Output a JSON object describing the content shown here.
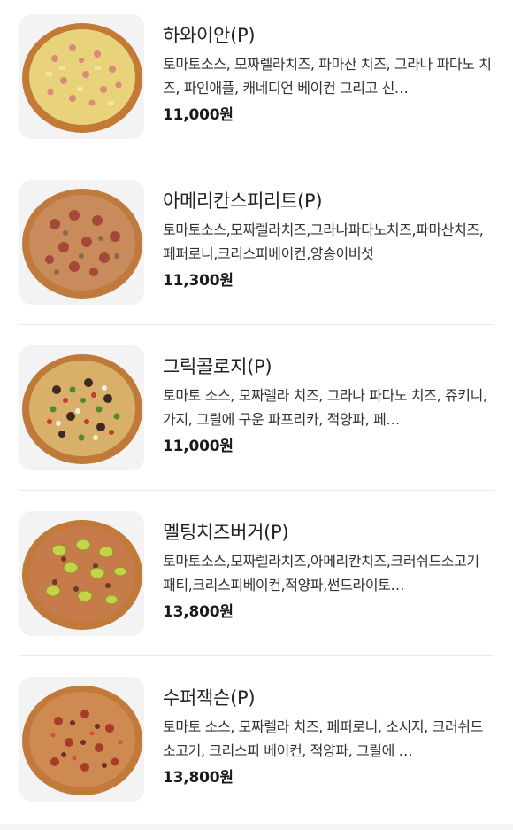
{
  "menu": {
    "items": [
      {
        "name": "하와이안(P)",
        "description": "토마토소스, 모짜렐라치즈, 파마산 치즈, 그라나 파다노 치즈, 파인애플, 캐네디언 베이컨 그리고 신…",
        "price": "11,000원",
        "image_icon": "hawaiian-pizza-image"
      },
      {
        "name": "아메리칸스피리트(P)",
        "description": "토마토소스,모짜렐라치즈,그라나파다노치즈,파마산치즈,페퍼로니,크리스피베이컨,양송이버섯",
        "price": "11,300원",
        "image_icon": "american-spirit-pizza-image"
      },
      {
        "name": "그릭콜로지(P)",
        "description": "토마토 소스, 모짜렐라 치즈, 그라나 파다노 치즈, 쥬키니, 가지, 그릴에 구운 파프리카, 적양파, 페…",
        "price": "11,000원",
        "image_icon": "greekology-pizza-image"
      },
      {
        "name": "멜팅치즈버거(P)",
        "description": "토마토소스,모짜렐라치즈,아메리칸치즈,크러쉬드소고기패티,크리스피베이컨,적양파,썬드라이토…",
        "price": "13,800원",
        "image_icon": "melting-cheese-burger-pizza-image"
      },
      {
        "name": "수퍼잭슨(P)",
        "description": "토마토 소스, 모짜렐라 치즈, 페퍼로니, 소시지, 크러쉬드 소고기, 크리스피 베이컨, 적양파, 그릴에 …",
        "price": "13,800원",
        "image_icon": "super-jackson-pizza-image"
      }
    ]
  },
  "colors": {
    "crust": "#c8843e",
    "crust_dark": "#a9652b",
    "cheese": "#e8c46a",
    "divider": "#ececec"
  }
}
